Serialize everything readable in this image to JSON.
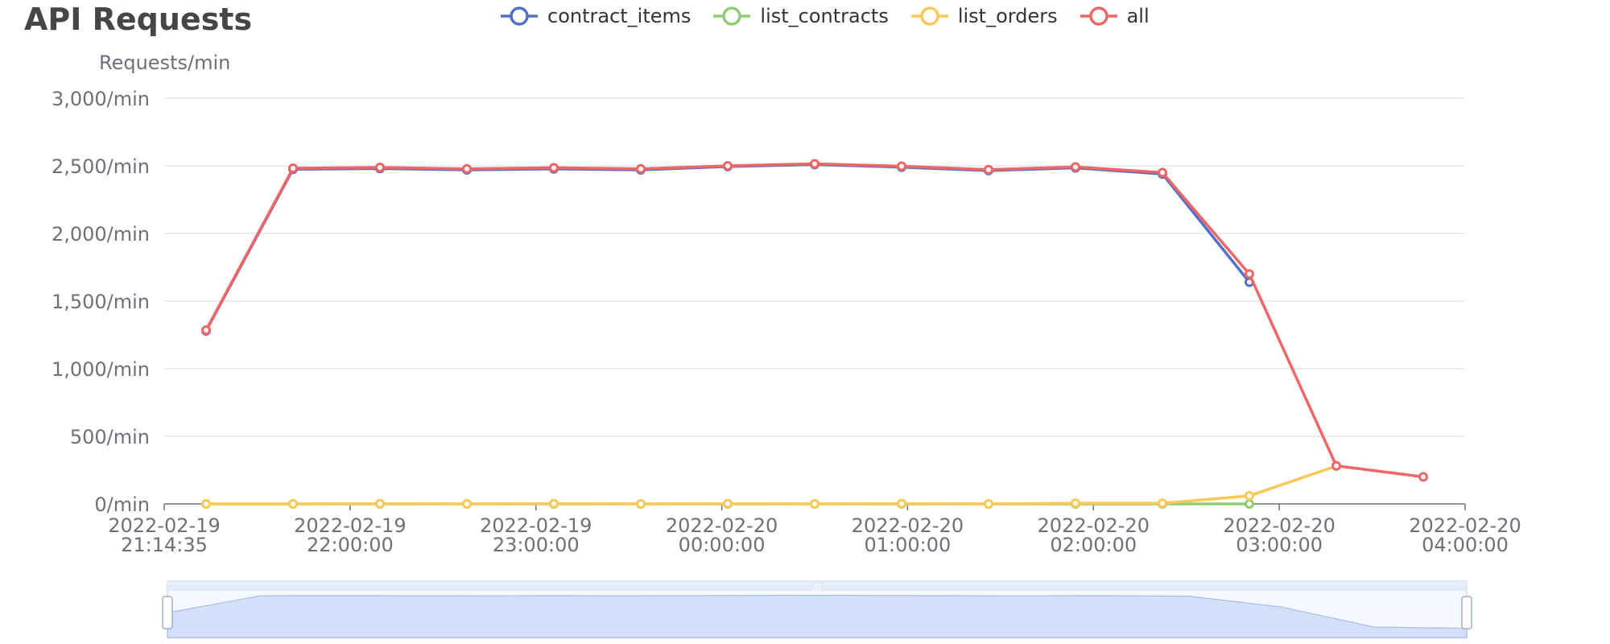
{
  "chart_data": {
    "type": "line",
    "title": "API Requests",
    "ylabel": "Requests/min",
    "ylim": [
      0,
      3000
    ],
    "yticks": [
      "0/min",
      "500/min",
      "1,000/min",
      "1,500/min",
      "2,000/min",
      "2,500/min",
      "3,000/min"
    ],
    "x_ticks": [
      [
        "2022-02-19",
        "21:14:35"
      ],
      [
        "2022-02-19",
        "22:00:00"
      ],
      [
        "2022-02-19",
        "23:00:00"
      ],
      [
        "2022-02-20",
        "00:00:00"
      ],
      [
        "2022-02-20",
        "01:00:00"
      ],
      [
        "2022-02-20",
        "02:00:00"
      ],
      [
        "2022-02-20",
        "03:00:00"
      ],
      [
        "2022-02-20",
        "04:00:00"
      ]
    ],
    "x": [
      "21:20",
      "21:50",
      "22:20",
      "22:50",
      "23:20",
      "23:50",
      "00:20",
      "00:50",
      "01:20",
      "01:50",
      "02:20",
      "02:50",
      "03:20",
      "03:50",
      "04:20"
    ],
    "grid": true,
    "legend_placement": "top",
    "series": [
      {
        "name": "contract_items",
        "color": "#5470c6",
        "values": [
          1280,
          2475,
          2480,
          2470,
          2478,
          2470,
          2495,
          2510,
          2490,
          2465,
          2485,
          2440,
          1640,
          null,
          null
        ]
      },
      {
        "name": "list_contracts",
        "color": "#91cc75",
        "values": [
          0,
          0,
          0,
          0,
          0,
          0,
          0,
          0,
          0,
          0,
          0,
          0,
          0,
          null,
          null
        ]
      },
      {
        "name": "list_orders",
        "color": "#fac858",
        "values": [
          0,
          0,
          2,
          0,
          2,
          0,
          2,
          0,
          2,
          0,
          5,
          5,
          60,
          280,
          null
        ]
      },
      {
        "name": "all",
        "color": "#ee6666",
        "values": [
          1285,
          2482,
          2488,
          2478,
          2486,
          2478,
          2500,
          2515,
          2497,
          2472,
          2492,
          2450,
          1700,
          282,
          200
        ]
      }
    ]
  }
}
